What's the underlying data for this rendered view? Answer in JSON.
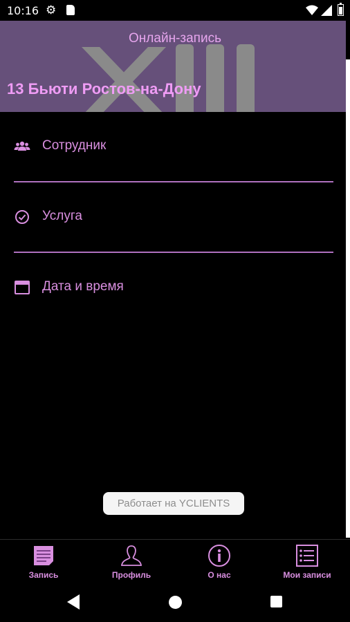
{
  "status_bar": {
    "time": "10:16"
  },
  "header": {
    "title": "Онлайн-запись",
    "company_name": "13 Бьюти Ростов-на-Дону"
  },
  "menu": {
    "items": [
      {
        "label": "Сотрудник",
        "icon": "people-icon"
      },
      {
        "label": "Услуга",
        "icon": "check-circle-icon"
      },
      {
        "label": "Дата и время",
        "icon": "calendar-icon"
      }
    ]
  },
  "powered_by": "Работает на YCLIENTS",
  "bottom_nav": {
    "items": [
      {
        "label": "Запись",
        "icon": "document-icon",
        "active": true
      },
      {
        "label": "Профиль",
        "icon": "person-icon"
      },
      {
        "label": "О нас",
        "icon": "info-icon"
      },
      {
        "label": "Мои записи",
        "icon": "list-icon"
      }
    ]
  },
  "colors": {
    "header_bg": "#66507a",
    "accent": "#d98fe0",
    "background": "#000000"
  }
}
